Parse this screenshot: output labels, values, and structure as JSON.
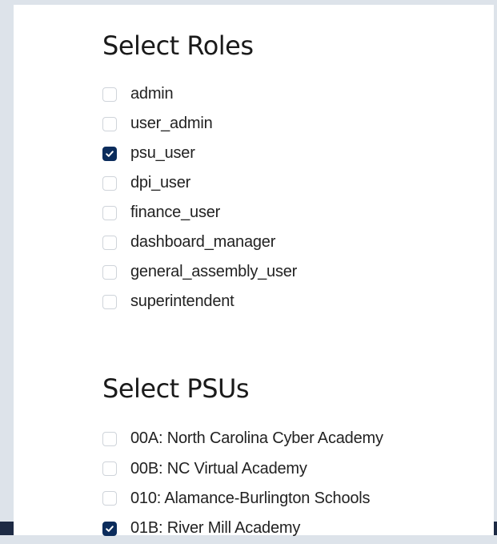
{
  "roles": {
    "title": "Select Roles",
    "items": [
      {
        "label": "admin",
        "checked": false
      },
      {
        "label": "user_admin",
        "checked": false
      },
      {
        "label": "psu_user",
        "checked": true
      },
      {
        "label": "dpi_user",
        "checked": false
      },
      {
        "label": "finance_user",
        "checked": false
      },
      {
        "label": "dashboard_manager",
        "checked": false
      },
      {
        "label": "general_assembly_user",
        "checked": false
      },
      {
        "label": "superintendent",
        "checked": false
      }
    ]
  },
  "psus": {
    "title": "Select PSUs",
    "items": [
      {
        "label": "00A: North Carolina Cyber Academy",
        "checked": false
      },
      {
        "label": "00B: NC Virtual Academy",
        "checked": false
      },
      {
        "label": "010: Alamance-Burlington Schools",
        "checked": false
      },
      {
        "label": "01B: River Mill Academy",
        "checked": true
      }
    ]
  },
  "colors": {
    "checked_fill": "#0b2c5c",
    "unchecked_border": "#cfd4da",
    "page_background": "#dde3ea",
    "footer_band": "#1d2a44"
  },
  "icons": {
    "checked": "checkmark-icon"
  }
}
